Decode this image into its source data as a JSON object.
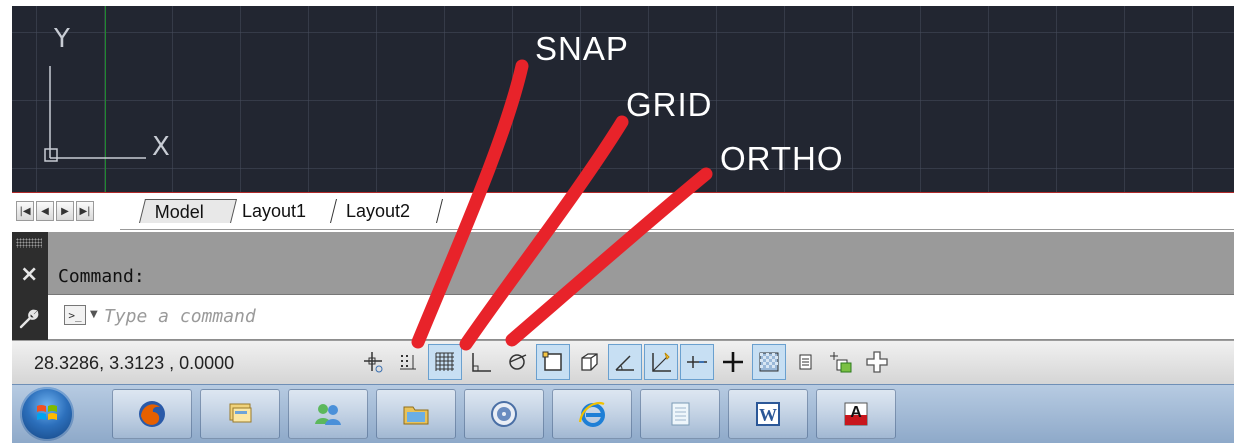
{
  "viewport": {
    "ucs_y_label": "Y",
    "ucs_x_label": "X"
  },
  "layout_tabs": {
    "nav_first": "first-tab-icon",
    "nav_prev": "prev-tab-icon",
    "nav_next": "next-tab-icon",
    "nav_last": "last-tab-icon",
    "tabs": [
      {
        "label": "Model",
        "active": true
      },
      {
        "label": "Layout1",
        "active": false
      },
      {
        "label": "Layout2",
        "active": false
      }
    ]
  },
  "command_line": {
    "history_label": "Command:",
    "prompt_icon": ">_",
    "input_placeholder": "Type a command",
    "close_icon": "×"
  },
  "status_bar": {
    "coordinates": "28.3286, 3.3123 , 0.0000",
    "toggles": [
      {
        "name": "infer-constraints",
        "on": false
      },
      {
        "name": "snap",
        "on": false
      },
      {
        "name": "grid",
        "on": true
      },
      {
        "name": "ortho",
        "on": false
      },
      {
        "name": "polar",
        "on": false
      },
      {
        "name": "osnap",
        "on": true
      },
      {
        "name": "3d-osnap",
        "on": false
      },
      {
        "name": "otrack",
        "on": true
      },
      {
        "name": "ducs",
        "on": true
      },
      {
        "name": "dyn",
        "on": true
      },
      {
        "name": "lineweight",
        "on": false
      },
      {
        "name": "transparency",
        "on": true
      },
      {
        "name": "quick-properties",
        "on": false
      },
      {
        "name": "selection-cycling",
        "on": false
      },
      {
        "name": "annotation-monitor",
        "on": false
      }
    ]
  },
  "taskbar": {
    "items": [
      "firefox",
      "windows-explorer-folders",
      "people",
      "file-manager",
      "itunes",
      "internet-explorer",
      "notepad",
      "word",
      "autocad"
    ],
    "word_letter": "W",
    "autocad_letter": "A"
  },
  "annotations": {
    "snap": "SNAP",
    "grid": "GRID",
    "ortho": "ORTHO",
    "color": "#e8232a"
  }
}
